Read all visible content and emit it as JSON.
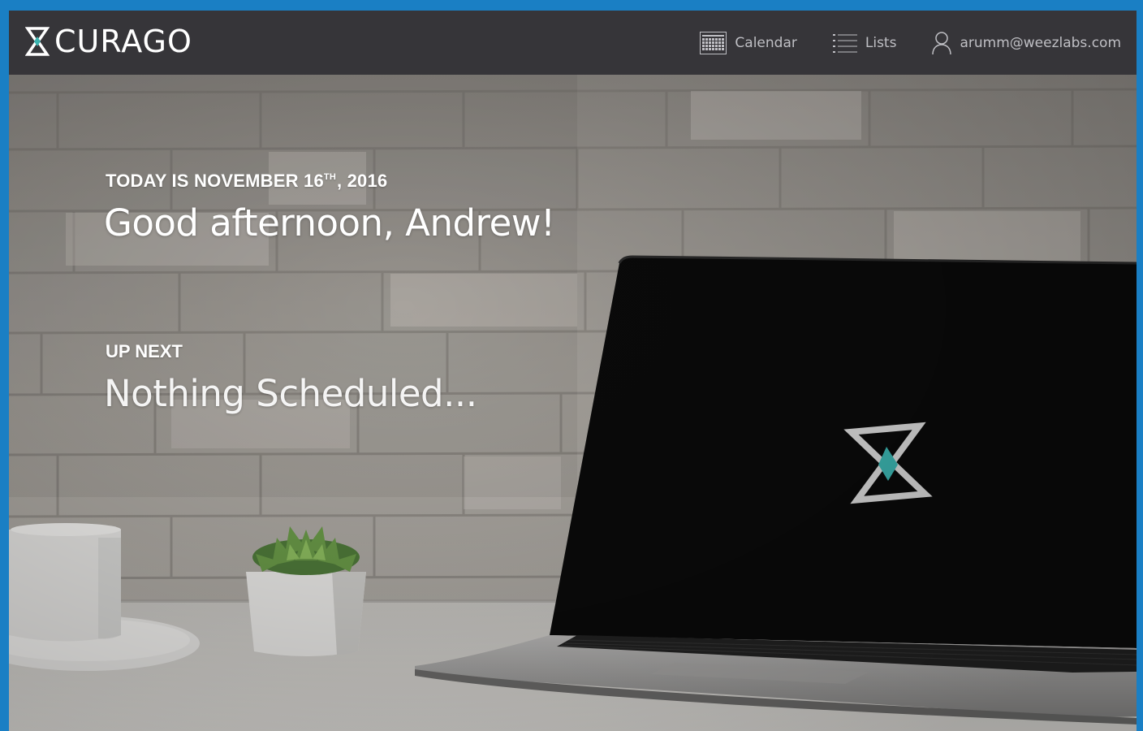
{
  "brand": {
    "name": "CURAGO"
  },
  "nav": {
    "calendar_label": "Calendar",
    "lists_label": "Lists",
    "user_email": "arumm@weezlabs.com"
  },
  "hero": {
    "date_prefix": "TODAY IS NOVEMBER 16",
    "date_suffix": "TH",
    "date_year": ", 2016",
    "greeting": "Good afternoon, Andrew!",
    "up_next_label": "UP NEXT",
    "up_next_value": "Nothing Scheduled..."
  },
  "colors": {
    "frame_border": "#1a7fc4",
    "navbar_bg": "#363539",
    "nav_text": "#bfbfc4",
    "brand_accent": "#3bb4b0"
  },
  "icons": {
    "brand": "hourglass-logo-icon",
    "calendar": "calendar-grid-icon",
    "lists": "list-icon",
    "user": "user-icon"
  }
}
